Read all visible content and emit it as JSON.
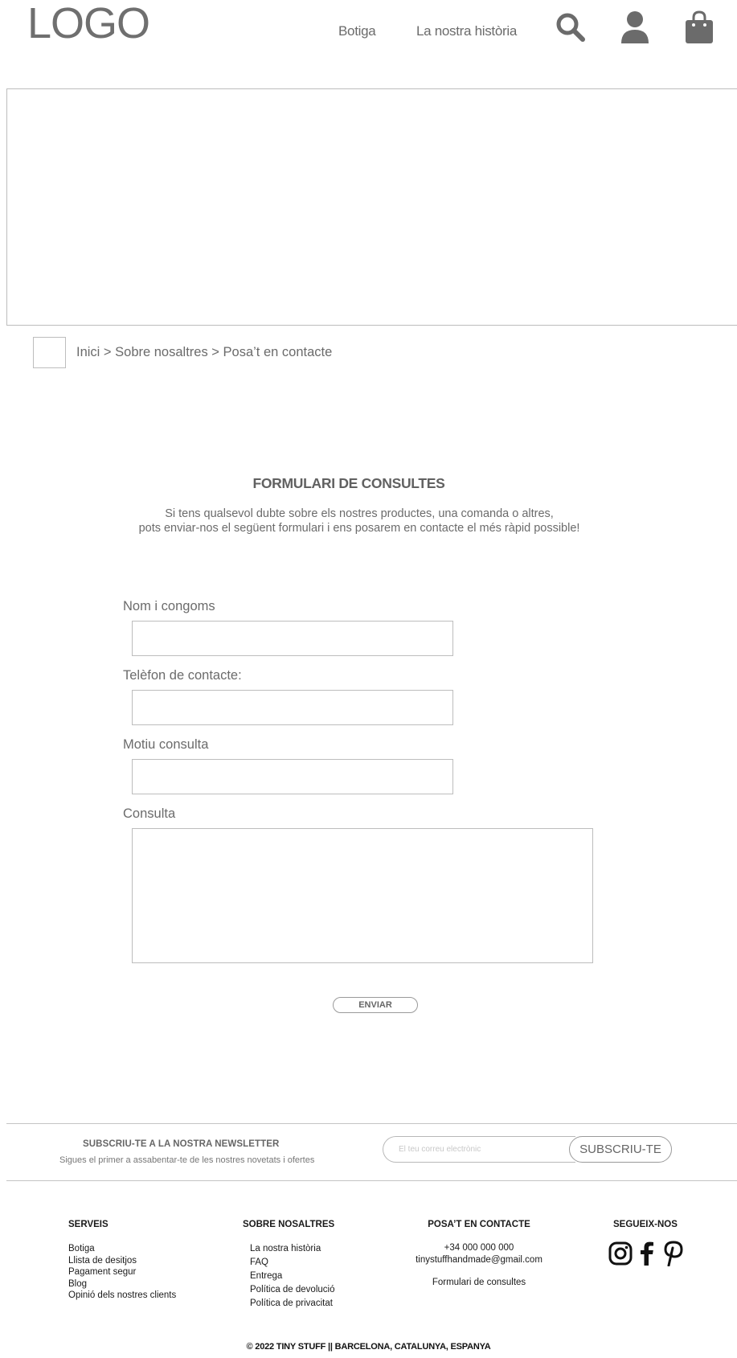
{
  "header": {
    "logo": "LOGO",
    "nav": [
      "Botiga",
      "La nostra història"
    ],
    "icons": [
      "search-icon",
      "user-icon",
      "shopping-bag-icon"
    ]
  },
  "breadcrumb": "Inici > Sobre nosaltres > Posa’t en contacte",
  "form": {
    "title": "FORMULARI DE CONSULTES",
    "intro_line1": "Si tens qualsevol dubte sobre els nostres productes, una comanda o altres,",
    "intro_line2": "pots enviar-nos el següent formulari i ens posarem en contacte el més ràpid possible!",
    "fields": [
      {
        "label": "Nom i congoms",
        "value": ""
      },
      {
        "label": "Telèfon de contacte:",
        "value": ""
      },
      {
        "label": "Motiu consulta",
        "value": ""
      },
      {
        "label": "Consulta",
        "value": ""
      }
    ],
    "submit": "ENVIAR"
  },
  "newsletter": {
    "title": "SUBSCRIU-TE A LA NOSTRA NEWSLETTER",
    "subtitle": "Sigues el primer a assabentar-te de les nostres novetats i ofertes",
    "placeholder": "El teu correu electrònic",
    "button": "SUBSCRIU-TE"
  },
  "footer": {
    "serveis": {
      "heading": "SERVEIS",
      "items": [
        "Botiga",
        "Llista de desitjos",
        "Pagament segur",
        "Blog",
        "Opinió dels nostres clients"
      ]
    },
    "sobre": {
      "heading": "SOBRE NOSALTRES",
      "items": [
        "La nostra història",
        "FAQ",
        "Entrega",
        "Política de devolució",
        "Política de privacitat"
      ]
    },
    "contacte": {
      "heading": "POSA’T EN CONTACTE",
      "phone": "+34 000 000 000",
      "email": "tinystuffhandmade@gmail.com",
      "form_link": "Formulari de consultes"
    },
    "segueix": {
      "heading": "SEGUEIX-NOS",
      "icons": [
        "instagram-icon",
        "facebook-icon",
        "pinterest-icon"
      ]
    },
    "copyright": "© 2022 TINY STUFF || BARCELONA, CATALUNYA, ESPANYA"
  },
  "colors": {
    "text": "#6b6b6b",
    "border": "#bdbdbd",
    "footer_text": "#1a1a1a"
  }
}
